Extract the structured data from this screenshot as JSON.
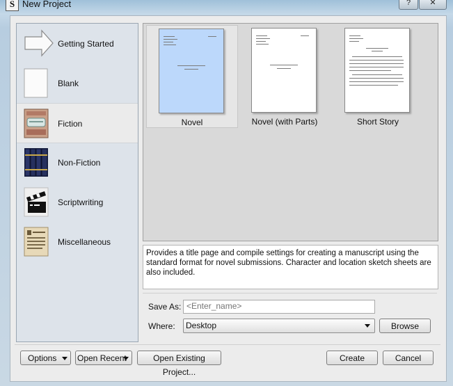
{
  "window": {
    "title": "New Project",
    "help_label": "?",
    "close_label": "✕",
    "app_icon_label": "S"
  },
  "sidebar": {
    "items": [
      {
        "label": "Getting Started",
        "icon": "arrow-icon",
        "selected": false
      },
      {
        "label": "Blank",
        "icon": "blank-page-icon",
        "selected": false
      },
      {
        "label": "Fiction",
        "icon": "fiction-book-icon",
        "selected": true
      },
      {
        "label": "Non-Fiction",
        "icon": "nonfiction-books-icon",
        "selected": false
      },
      {
        "label": "Scriptwriting",
        "icon": "clapperboard-icon",
        "selected": false
      },
      {
        "label": "Miscellaneous",
        "icon": "notepaper-icon",
        "selected": false
      }
    ]
  },
  "templates": [
    {
      "label": "Novel",
      "selected": true
    },
    {
      "label": "Novel (with Parts)",
      "selected": false
    },
    {
      "label": "Short Story",
      "selected": false
    }
  ],
  "description": "Provides a title page and compile settings for creating a manuscript using the standard format for novel submissions. Character and location sketch sheets are also included.",
  "form": {
    "save_as_label": "Save As:",
    "save_as_placeholder": "<Enter_name>",
    "where_label": "Where:",
    "where_value": "Desktop",
    "browse_label": "Browse"
  },
  "footer": {
    "options_label": "Options",
    "open_recent_label": "Open Recent",
    "open_existing_label": "Open Existing Project...",
    "create_label": "Create",
    "cancel_label": "Cancel"
  },
  "colors": {
    "selected_template": "#bcd8fb",
    "sidebar_bg": "#dde3ea"
  }
}
